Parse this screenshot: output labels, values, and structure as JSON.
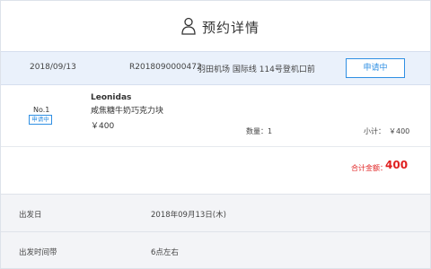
{
  "header": {
    "title": "预约详情",
    "icon": "user-icon"
  },
  "order": {
    "date": "2018/09/13",
    "number": "R2018090000472",
    "location": "羽田机场 国际线 114号登机口前",
    "status": "申请中",
    "accent_color": "#2f8fe3"
  },
  "item": {
    "no": "No.1",
    "badge": "申请中",
    "name": "Leonidas",
    "desc": "咸焦糖牛奶巧克力块",
    "price": "￥400",
    "quantity": "数量：1",
    "subtotal_label": "小计：",
    "subtotal_value": "￥400"
  },
  "total": {
    "label": "合计金额：",
    "value": "400",
    "color": "#e02020"
  },
  "info": [
    {
      "key": "出发日",
      "value": "2018年09月13日(木)"
    },
    {
      "key": "出发时间带",
      "value": "6点左右"
    }
  ]
}
